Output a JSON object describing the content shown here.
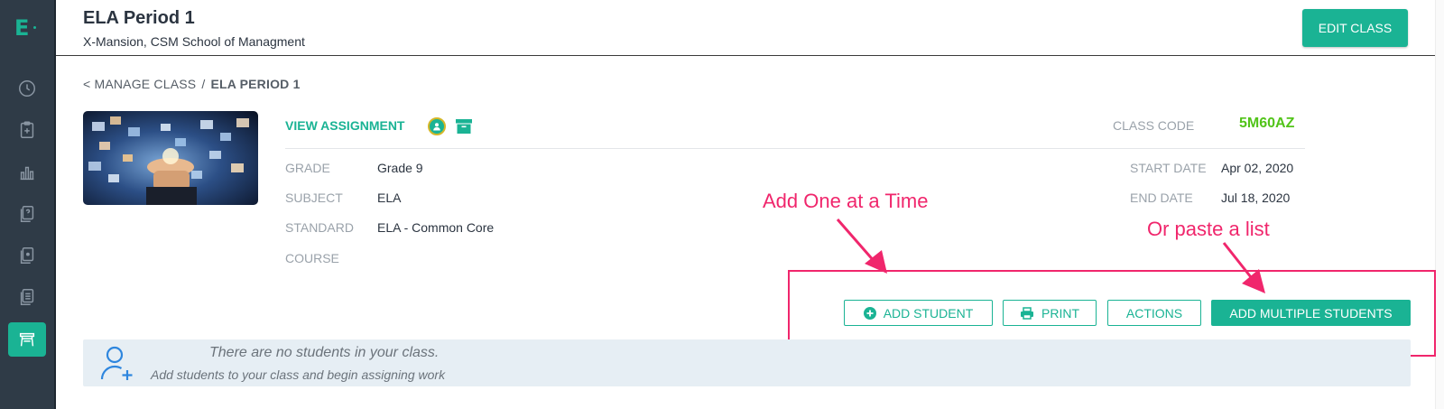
{
  "app": {
    "logo": "E"
  },
  "header": {
    "title": "ELA Period 1",
    "subtitle": "X-Mansion, CSM School of Managment",
    "edit_button": "EDIT CLASS"
  },
  "breadcrumb": {
    "back": "< MANAGE CLASS",
    "separator": "/",
    "current": "ELA PERIOD 1"
  },
  "class_info": {
    "view_assignment": "VIEW ASSIGNMENT",
    "class_code_label": "CLASS CODE",
    "class_code_value": "5M60AZ",
    "grade_label": "GRADE",
    "grade_value": "Grade 9",
    "subject_label": "SUBJECT",
    "subject_value": "ELA",
    "standard_label": "STANDARD",
    "standard_value": "ELA - Common Core",
    "course_label": "COURSE",
    "start_date_label": "START DATE",
    "start_date_value": "Apr 02, 2020",
    "end_date_label": "END DATE",
    "end_date_value": "Jul 18, 2020"
  },
  "annotations": {
    "add_one": "Add One at a Time",
    "paste_list": "Or paste a list"
  },
  "actions": {
    "add_student": "ADD STUDENT",
    "print": "PRINT",
    "actions": "ACTIONS",
    "add_multiple": "ADD MULTIPLE STUDENTS"
  },
  "empty_state": {
    "title": "There are no students in your class.",
    "subtitle": "Add students to your class and begin assigning work"
  },
  "colors": {
    "accent": "#1ab394",
    "sidebar": "#2f3b47",
    "annotation": "#f0266c",
    "code": "#52c41a"
  },
  "sidebar_icons": [
    "dashboard-icon",
    "assignment-add-icon",
    "reports-icon",
    "question-bank-icon",
    "library-icon",
    "documents-icon",
    "classes-icon"
  ]
}
